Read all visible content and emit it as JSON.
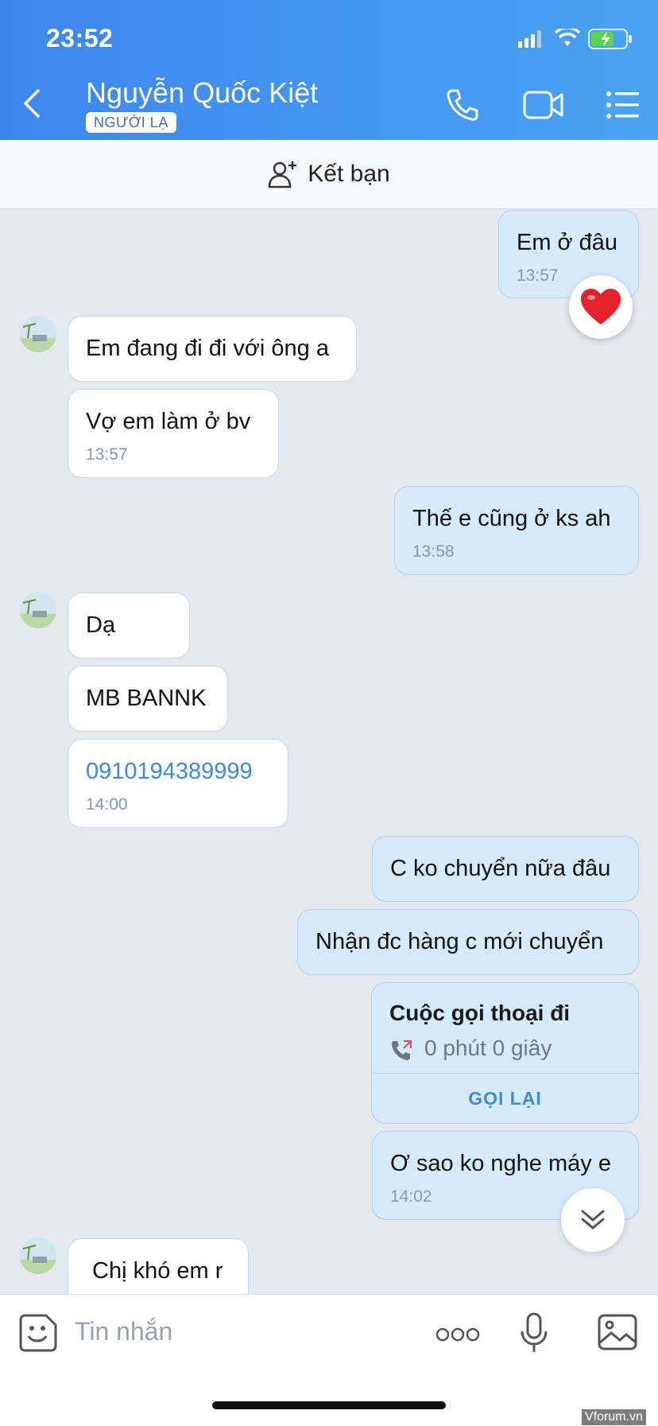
{
  "status_bar": {
    "time": "23:52"
  },
  "header": {
    "contact_name": "Nguyễn Quốc Kiệt",
    "stranger_badge": "NGƯỜI LẠ",
    "icons": [
      "back-icon",
      "phone-icon",
      "video-icon",
      "menu-icon"
    ]
  },
  "add_friend": {
    "label": "Kết bạn",
    "icon": "add-user-icon"
  },
  "messages": [
    {
      "from": "me",
      "text": "Em ở đâu",
      "time": "13:57",
      "reaction": "heart"
    },
    {
      "from": "them",
      "text": "Em đang đi đi với ông a"
    },
    {
      "from": "them",
      "text": "Vợ em làm ở bv",
      "time": "13:57"
    },
    {
      "from": "me",
      "text": "Thế e cũng ở ks ah",
      "time": "13:58"
    },
    {
      "from": "them",
      "text": "Dạ"
    },
    {
      "from": "them",
      "text": "MB BANNK"
    },
    {
      "from": "them",
      "text": "0910194389999",
      "time": "14:00",
      "is_link": true
    },
    {
      "from": "me",
      "text": "C ko chuyển nữa đâu"
    },
    {
      "from": "me",
      "text": "Nhận đc hàng c mới chuyển"
    },
    {
      "from": "me",
      "text": "Ơ sao ko nghe máy e",
      "time": "14:02"
    },
    {
      "from": "them",
      "text": "Chị khó em r"
    }
  ],
  "call_card": {
    "title": "Cuộc gọi thoại đi",
    "duration": "0 phút 0 giây",
    "action": "GỌI LẠI"
  },
  "input_bar": {
    "placeholder": "Tin nhắn",
    "icons": [
      "sticker-icon",
      "more-icon",
      "microphone-icon",
      "image-icon"
    ]
  },
  "watermark": "Vforum.vn",
  "colors": {
    "header_start": "#3d86ee",
    "header_end": "#4aa3f2",
    "my_bubble": "#d5ebfb",
    "link": "#3f8ad6"
  }
}
